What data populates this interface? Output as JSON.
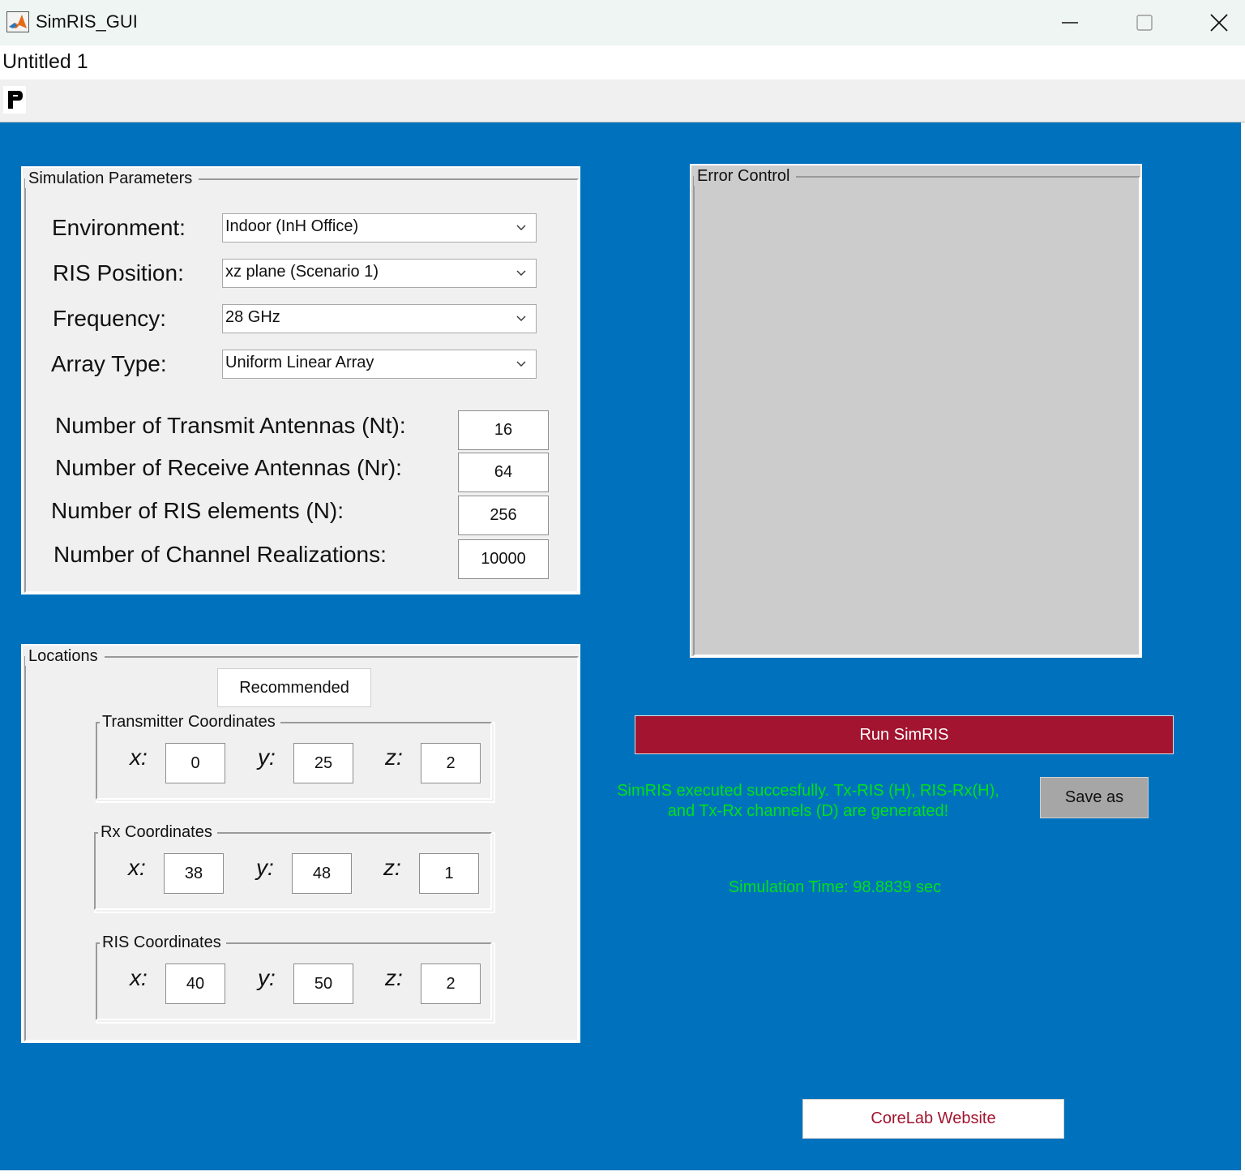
{
  "window": {
    "title": "SimRIS_GUI",
    "minimize_icon": "minimize-icon",
    "maximize_icon": "maximize-icon",
    "close_icon": "close-icon"
  },
  "tab": {
    "title": "Untitled 1"
  },
  "toolbar": {
    "pin_icon": "pin-icon"
  },
  "simulation_parameters": {
    "title": "Simulation Parameters",
    "environment": {
      "label": "Environment:",
      "value": "Indoor (InH Office)"
    },
    "ris_position": {
      "label": "RIS Position:",
      "value": "xz plane (Scenario 1)"
    },
    "frequency": {
      "label": "Frequency:",
      "value": "28 GHz"
    },
    "array_type": {
      "label": "Array Type:",
      "value": "Uniform Linear Array"
    },
    "nt": {
      "label": "Number of Transmit Antennas (Nt):",
      "value": "16"
    },
    "nr": {
      "label": "Number of Receive Antennas (Nr):",
      "value": "64"
    },
    "n": {
      "label": "Number of RIS elements (N):",
      "value": "256"
    },
    "realizations": {
      "label": "Number of Channel Realizations:",
      "value": "10000"
    }
  },
  "locations": {
    "title": "Locations",
    "recommended_label": "Recommended",
    "x_label": "x:",
    "y_label": "y:",
    "z_label": "z:",
    "tx": {
      "title": "Transmitter Coordinates",
      "x": "0",
      "y": "25",
      "z": "2"
    },
    "rx": {
      "title": "Rx Coordinates",
      "x": "38",
      "y": "48",
      "z": "1"
    },
    "ris": {
      "title": "RIS Coordinates",
      "x": "40",
      "y": "50",
      "z": "2"
    }
  },
  "error_control": {
    "title": "Error Control"
  },
  "run": {
    "label": "Run SimRIS"
  },
  "status": {
    "line1": "SimRIS executed succesfully. Tx-RIS (H), RIS-Rx(H),",
    "line2": "and Tx-Rx channels (D) are generated!",
    "time": "Simulation Time: 98.8839 sec"
  },
  "save": {
    "label": "Save as"
  },
  "website": {
    "label": "CoreLab Website"
  },
  "colors": {
    "canvas": "#0072bd",
    "run_button": "#a2142f",
    "status_text": "#00e01a",
    "link_text": "#a2142f"
  }
}
